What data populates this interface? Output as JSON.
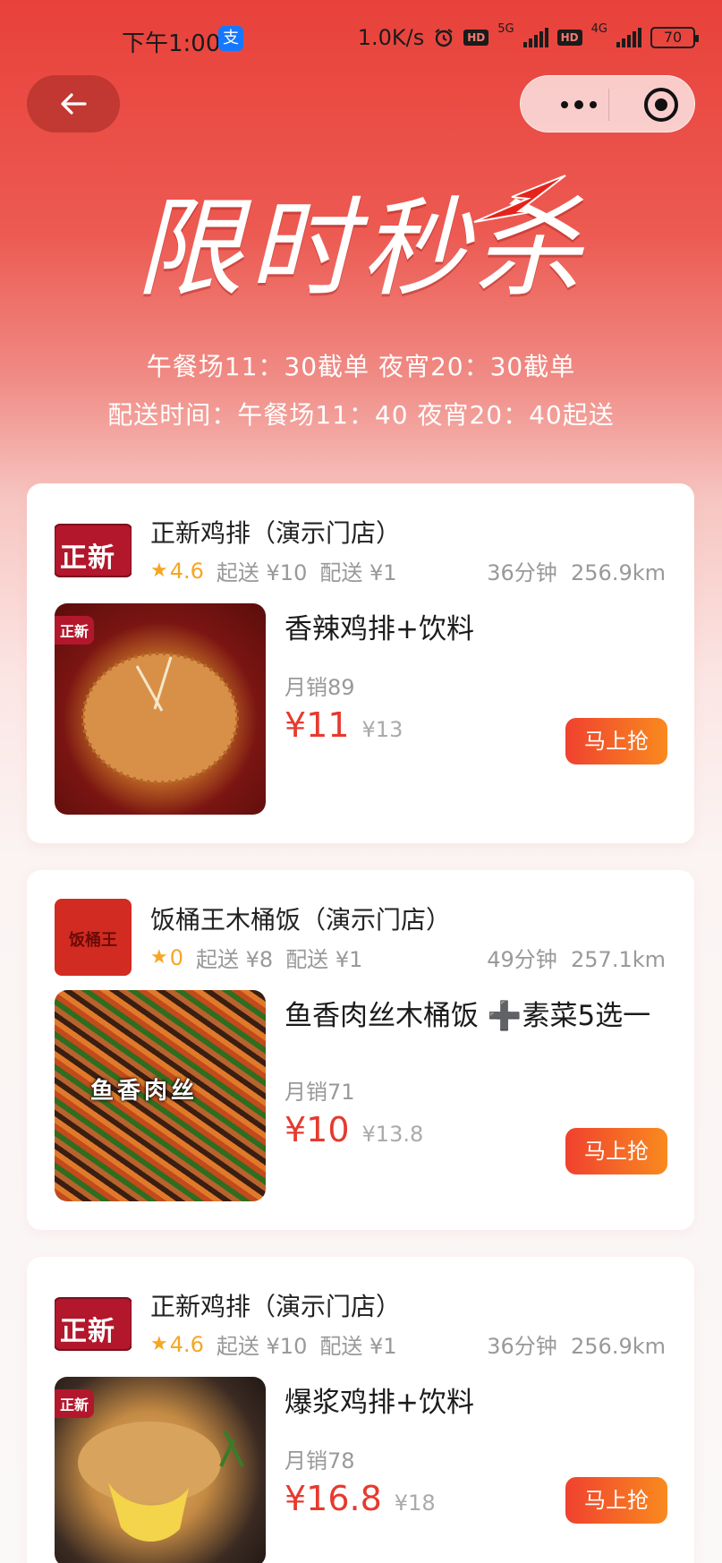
{
  "status_bar": {
    "time": "下午1:00",
    "net_speed": "1.0K/s",
    "hd": "HD",
    "net1": "5G",
    "net2": "4G",
    "battery": "70",
    "alipay_glyph": "支"
  },
  "nav": {
    "back_icon": "arrow-left-icon",
    "more_icon": "more-dots-icon",
    "close_icon": "target-icon"
  },
  "banner": {
    "title": "限时秒杀",
    "cutoff": "午餐场11：30截单 夜宵20：30截单",
    "delivery": "配送时间：午餐场11：40 夜宵20：40起送"
  },
  "colors": {
    "accent": "#e63a2e",
    "button_start": "#f0412f",
    "button_end": "#f98a1e",
    "rating": "#f5a623"
  },
  "cards": [
    {
      "logo_text": "正新",
      "store": "正新鸡排（演示门店）",
      "rating": "4.6",
      "min_order": "起送 ¥10",
      "delivery_fee": "配送 ¥1",
      "eta": "36分钟",
      "distance": "256.9km",
      "dish": "香辣鸡排+饮料",
      "sales": "月销89",
      "price": "¥11",
      "orig_price": "¥13",
      "button": "马上抢"
    },
    {
      "logo_text": "饭桶王",
      "store": "饭桶王木桶饭（演示门店）",
      "rating": "0",
      "min_order": "起送 ¥8",
      "delivery_fee": "配送 ¥1",
      "eta": "49分钟",
      "distance": "257.1km",
      "dish": "鱼香肉丝木桶饭 ➕素菜5选一",
      "pic_caption": "鱼香肉丝",
      "sales": "月销71",
      "price": "¥10",
      "orig_price": "¥13.8",
      "button": "马上抢"
    },
    {
      "logo_text": "正新",
      "store": "正新鸡排（演示门店）",
      "rating": "4.6",
      "min_order": "起送 ¥10",
      "delivery_fee": "配送 ¥1",
      "eta": "36分钟",
      "distance": "256.9km",
      "dish": "爆浆鸡排+饮料",
      "sales": "月销78",
      "price": "¥16.8",
      "orig_price": "¥18",
      "button": "马上抢"
    }
  ]
}
